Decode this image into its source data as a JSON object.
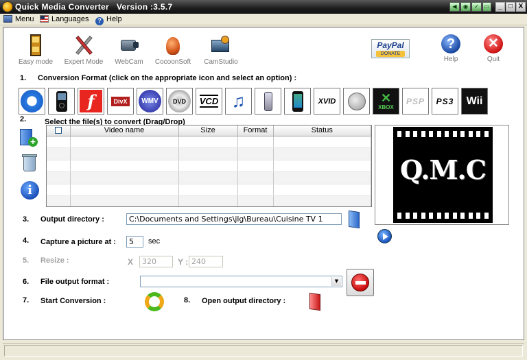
{
  "window": {
    "title": "Quick Media Converter   Version :3.5.7",
    "controls": {
      "minimize": "_",
      "maximize": "□",
      "close": "X"
    }
  },
  "menu": [
    {
      "label": "Menu",
      "icon": "menu-icon"
    },
    {
      "label": "Languages",
      "icon": "us-flag-icon"
    },
    {
      "label": "Help",
      "icon": "help-circle-icon"
    }
  ],
  "toolbar": {
    "easy_mode": "Easy mode",
    "expert_mode": "Expert Mode",
    "webcam": "WebCam",
    "cocoonsoft": "CocoonSoft",
    "camstudio": "CamStudio",
    "paypal_line1": "PayPal",
    "paypal_line2": "DONATE",
    "help": "Help",
    "quit": "Quit"
  },
  "steps": {
    "s1_num": "1.",
    "s1_label": "Conversion Format (click on the appropriate icon and select an option) :",
    "s2_num": "2.",
    "s2_label": "Select the  file(s) to convert (Drag/Drop)",
    "s3_num": "3.",
    "s3_label": "Output directory :",
    "s4_num": "4.",
    "s4_label": "Capture a picture at :",
    "s5_num": "5.",
    "s5_label": "Resize :",
    "s6_num": "6.",
    "s6_label": "File output format :",
    "s7_num": "7.",
    "s7_label": "Start Conversion :",
    "s8_num": "8.",
    "s8_label": "Open output directory :"
  },
  "formats": [
    {
      "name": "quicktime",
      "label": ""
    },
    {
      "name": "ipod",
      "label": ""
    },
    {
      "name": "flash",
      "label": ""
    },
    {
      "name": "divx",
      "label": "DivX"
    },
    {
      "name": "wmv",
      "label": "WMV"
    },
    {
      "name": "dvd",
      "label": "DVD"
    },
    {
      "name": "vcd",
      "label": "VCD"
    },
    {
      "name": "music",
      "label": ""
    },
    {
      "name": "mobile",
      "label": ""
    },
    {
      "name": "iphone",
      "label": ""
    },
    {
      "name": "xvid",
      "label": "XVID"
    },
    {
      "name": "satellite",
      "label": ""
    },
    {
      "name": "xbox",
      "label": "XBOX"
    },
    {
      "name": "psp",
      "label": "PSP"
    },
    {
      "name": "ps3",
      "label": "PS3"
    },
    {
      "name": "wii",
      "label": "Wii"
    }
  ],
  "file_table": {
    "columns": [
      "",
      "Video name",
      "Size",
      "Format",
      "Status"
    ],
    "rows": [
      [
        "",
        "",
        "",
        "",
        ""
      ],
      [
        "",
        "",
        "",
        "",
        ""
      ],
      [
        "",
        "",
        "",
        "",
        ""
      ],
      [
        "",
        "",
        "",
        "",
        ""
      ],
      [
        "",
        "",
        "",
        "",
        ""
      ],
      [
        "",
        "",
        "",
        "",
        ""
      ]
    ]
  },
  "preview": {
    "title": "Q.M.C"
  },
  "output_directory": "C:\\Documents and Settings\\jlg\\Bureau\\Cuisine TV 1",
  "capture": {
    "value": "5",
    "unit": "sec"
  },
  "resize": {
    "x_label": "X",
    "x_value": "320",
    "y_label": "Y :",
    "y_value": "240"
  },
  "file_output_format": {
    "selected": ""
  },
  "colors": {
    "title_bar": "#1e1e1e",
    "client_bg": "#ffffff",
    "label_dim": "#a0a0a0"
  }
}
